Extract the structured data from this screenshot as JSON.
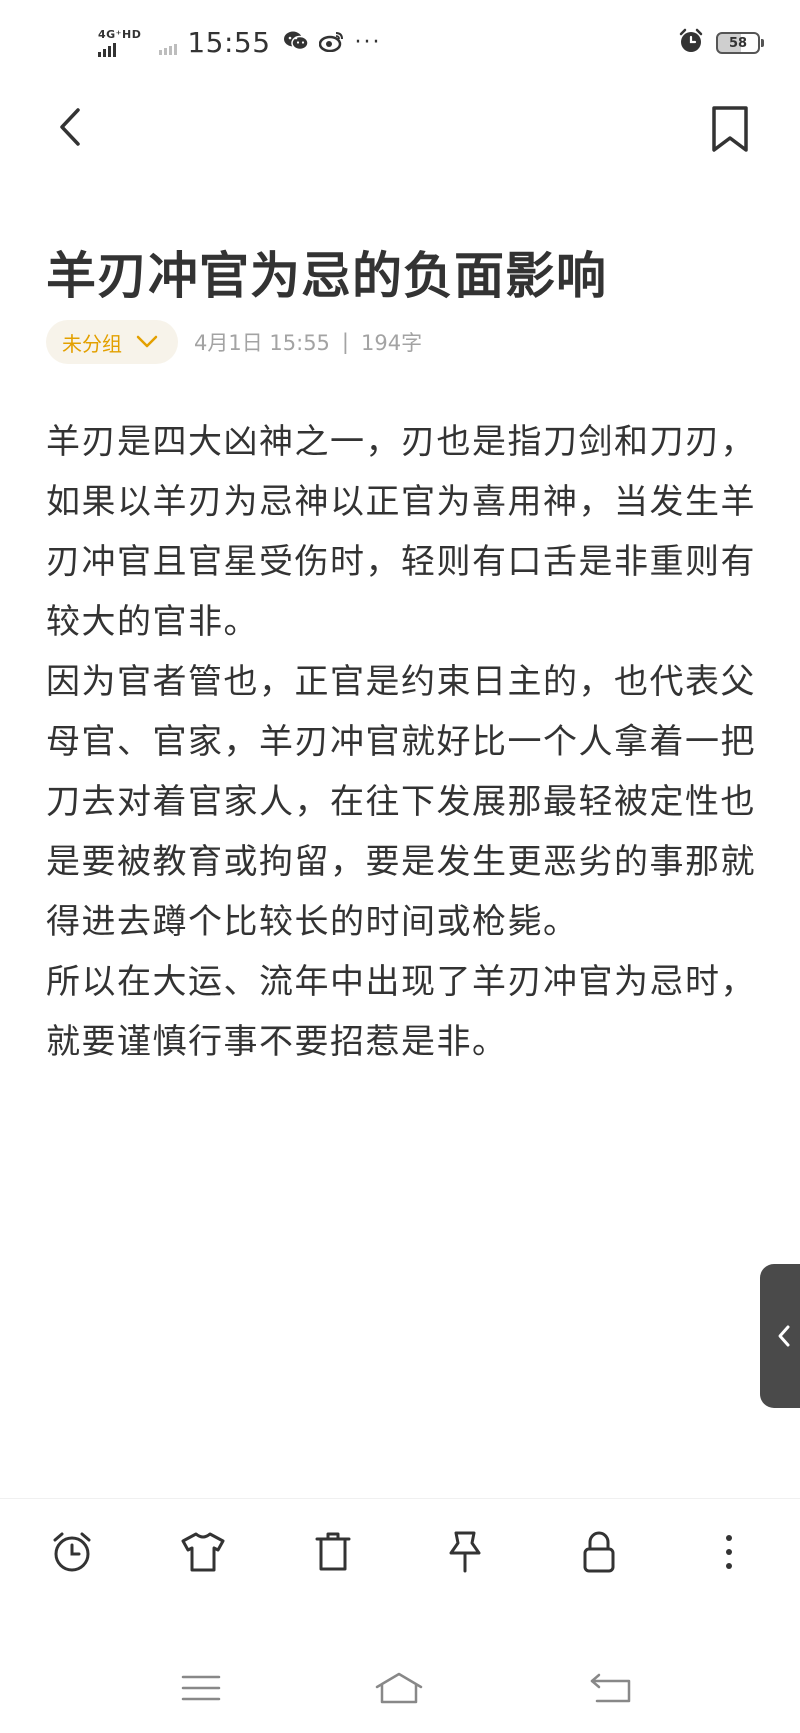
{
  "status_bar": {
    "network_label": "4G⁺HD",
    "time": "15:55",
    "more_indicator": "···",
    "battery_level": "58",
    "icons": [
      "signal-icon",
      "wechat-icon",
      "weibo-icon",
      "alarm-icon",
      "battery-icon"
    ]
  },
  "nav": {
    "back_icon": "chevron-left-icon",
    "bookmark_icon": "bookmark-icon"
  },
  "note": {
    "title": "羊刃冲官为忌的负面影响",
    "group_label": "未分组",
    "date": "4月1日 15:55",
    "separator": "|",
    "word_count": "194字",
    "paragraphs": [
      "羊刃是四大凶神之一，刃也是指刀剑和刀刃，如果以羊刃为忌神以正官为喜用神，当发生羊刃冲官且官星受伤时，轻则有口舌是非重则有较大的官非。",
      "因为官者管也，正官是约束日主的，也代表父母官、官家，羊刃冲官就好比一个人拿着一把刀去对着官家人，在往下发展那最轻被定性也是要被教育或拘留，要是发生更恶劣的事那就得进去蹲个比较长的时间或枪毙。",
      "所以在大运、流年中出现了羊刃冲官为忌时，就要谨慎行事不要招惹是非。"
    ]
  },
  "toolbar": {
    "items": [
      "alarm-clock-icon",
      "shirt-icon",
      "trash-icon",
      "pin-icon",
      "lock-icon",
      "more-vertical-icon"
    ]
  },
  "system_nav": {
    "items": [
      "menu-icon",
      "home-icon",
      "back-icon"
    ]
  },
  "colors": {
    "accent": "#e3a000",
    "chip_bg": "#f7f3ea",
    "meta_text": "#a3a3a3",
    "body_text": "#333333"
  }
}
